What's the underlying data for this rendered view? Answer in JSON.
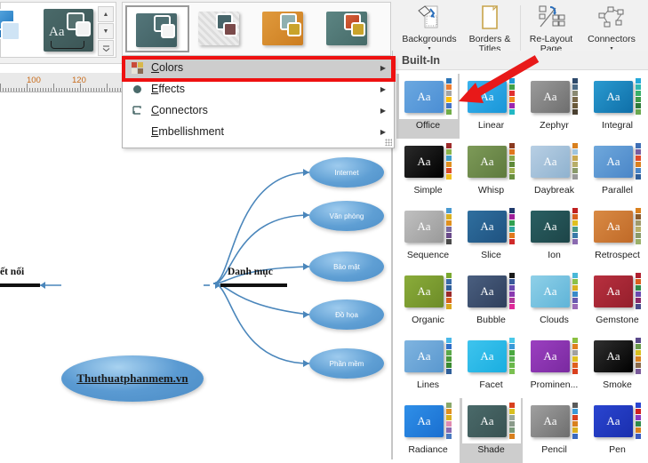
{
  "ribbon": {
    "gallery_thumbs": [
      {
        "name": "theme-thumb-shade",
        "selected": true,
        "base": "#4a6a6a",
        "ov1": "#55706f",
        "ov2": "#f2f2f2"
      },
      {
        "name": "theme-thumb-striped",
        "selected": false,
        "base": "#e8e8e8",
        "ov1": "#47656a",
        "ov2": "#7a4a4a"
      },
      {
        "name": "theme-thumb-orange",
        "selected": false,
        "base": "#d5882c",
        "ov1": "#7fa5a5",
        "ov2": "#c9a32b"
      },
      {
        "name": "theme-thumb-teal-red",
        "selected": false,
        "base": "#507a78",
        "ov1": "#c4502c",
        "ov2": "#c9a32b"
      }
    ],
    "buttons": [
      {
        "label": "Backgrounds",
        "icon": "backgrounds-icon",
        "caret": "▾"
      },
      {
        "label": "Borders &\nTitles",
        "icon": "borders-titles-icon",
        "caret": "▾"
      },
      {
        "label": "Re-Layout\nPage",
        "icon": "relayout-page-icon",
        "caret": "▾"
      },
      {
        "label": "Connectors",
        "icon": "connectors-icon",
        "caret": "▾"
      }
    ],
    "scroll": {
      "up": "▲",
      "down": "▼",
      "more": "▾"
    }
  },
  "menu": {
    "items": [
      {
        "label": "Colors",
        "accel": "C",
        "icon": "colors-swatch-icon",
        "arrow": "▶",
        "highlighted": true
      },
      {
        "label": "Effects",
        "accel": "E",
        "icon": "effects-dot-icon",
        "arrow": "▶",
        "highlighted": false
      },
      {
        "label": "Connectors",
        "accel": "C",
        "icon": "connectors-shape-icon",
        "arrow": "▶",
        "highlighted": false
      },
      {
        "label": "Embellishment",
        "accel": "E",
        "icon": "",
        "arrow": "▶",
        "highlighted": false
      }
    ],
    "highlight_color": "#ee1111"
  },
  "ruler": {
    "marks": [
      "100",
      "120"
    ],
    "unit_color": "#c86a18"
  },
  "mindmap": {
    "center_node": "Thuthuatphanmem.vn",
    "left_branch_label": "ết nối",
    "right_branch_label": "Danh mục",
    "children": [
      "Internet",
      "Văn phòng",
      "Bảo mật",
      "Đồ họa",
      "Phần mềm"
    ],
    "node_color": "#5a9ad2",
    "connector_color": "#4a86bb"
  },
  "panel": {
    "header": "Built-In",
    "themes": [
      {
        "name": "Office",
        "card": "linear-gradient(135deg,#6ba8e0,#4b8ed4)",
        "state": "selected",
        "dots": [
          "#2e75b6",
          "#ed7d31",
          "#a5a5a5",
          "#ffc000",
          "#4472c4",
          "#70ad47"
        ]
      },
      {
        "name": "Linear",
        "card": "linear-gradient(135deg,#3bb3ee,#1996d8)",
        "state": "none",
        "dots": [
          "#1f9ad6",
          "#43a047",
          "#e03030",
          "#f08a1e",
          "#9b27b0",
          "#22b8c4"
        ]
      },
      {
        "name": "Zephyr",
        "card": "linear-gradient(135deg,#9b9b9b,#6e6e6e)",
        "state": "none",
        "dots": [
          "#2e4a6b",
          "#4b6b86",
          "#8a8a72",
          "#7a6a4a",
          "#6b5a3a",
          "#4a4030"
        ]
      },
      {
        "name": "Integral",
        "card": "linear-gradient(135deg,#2a9ad0,#0f6fa8)",
        "state": "none",
        "dots": [
          "#25a8d8",
          "#2fb8b0",
          "#38b06a",
          "#3f9c4a",
          "#2e7a3a",
          "#6aa84f"
        ]
      },
      {
        "name": "Simple",
        "card": "linear-gradient(135deg,#2a2a2a,#000000)",
        "state": "none",
        "dots": [
          "#9e2b2b",
          "#8ab54a",
          "#3f9ec9",
          "#e09020",
          "#d94a2a",
          "#f0c020"
        ]
      },
      {
        "name": "Whisp",
        "card": "linear-gradient(135deg,#7d9a58,#5e7a3e)",
        "state": "none",
        "dots": [
          "#8a3a20",
          "#e0761e",
          "#8aa84a",
          "#5f8a3a",
          "#a0b050",
          "#6a9040"
        ]
      },
      {
        "name": "Daybreak",
        "card": "linear-gradient(135deg,#b8cfe4,#8fb2cf)",
        "state": "none",
        "dots": [
          "#d9801e",
          "#9ec4de",
          "#c9a850",
          "#b8ae6a",
          "#8a9a6a",
          "#9a9a9a"
        ]
      },
      {
        "name": "Parallel",
        "card": "linear-gradient(135deg,#6fa8dc,#4a86c8)",
        "state": "none",
        "dots": [
          "#3f6fb5",
          "#7a5ea0",
          "#e04a2a",
          "#d9801e",
          "#4a86c8",
          "#2f5f9a"
        ]
      },
      {
        "name": "Sequence",
        "card": "linear-gradient(135deg,#c0c0c0,#9a9a9a)",
        "state": "none",
        "dots": [
          "#4a9ad0",
          "#d9b020",
          "#e0901e",
          "#7a6aa0",
          "#6a4a8a",
          "#4a4a4a"
        ]
      },
      {
        "name": "Slice",
        "card": "linear-gradient(135deg,#2f6f9f,#1f5280)",
        "state": "none",
        "dots": [
          "#1f3a6b",
          "#a0209a",
          "#30a050",
          "#30a8a0",
          "#e07a1e",
          "#d02a2a"
        ]
      },
      {
        "name": "Ion",
        "card": "linear-gradient(135deg,#2a5f62,#1d4548)",
        "state": "none",
        "dots": [
          "#c02020",
          "#d9601e",
          "#e0c020",
          "#4a9a8a",
          "#3a7aa8",
          "#8a6ab0"
        ]
      },
      {
        "name": "Retrospect",
        "card": "linear-gradient(135deg,#d98a44,#c06a28)",
        "state": "none",
        "dots": [
          "#d9801e",
          "#8a5a2a",
          "#a09a6a",
          "#b8b06a",
          "#8a9a6a",
          "#9ab06a"
        ]
      },
      {
        "name": "Organic",
        "card": "linear-gradient(135deg,#8aac3a,#6d8c28)",
        "state": "none",
        "dots": [
          "#7aa830",
          "#3a6aa8",
          "#2f5f9a",
          "#9a2a2a",
          "#d9601e",
          "#d9a820"
        ]
      },
      {
        "name": "Bubble",
        "card": "linear-gradient(135deg,#4a5f80,#2f3f5c)",
        "state": "none",
        "dots": [
          "#1a1a1a",
          "#3a5a9a",
          "#6a4ab0",
          "#8a3ab0",
          "#b03a9a",
          "#e02a9a"
        ]
      },
      {
        "name": "Clouds",
        "card": "linear-gradient(135deg,#8fd0e8,#5fb4d8)",
        "state": "none",
        "dots": [
          "#4ab8d8",
          "#8ac04a",
          "#d9b020",
          "#3a8ac8",
          "#6a5ab0",
          "#9a6ab8"
        ]
      },
      {
        "name": "Gemstone",
        "card": "linear-gradient(135deg,#b8303f,#951f2c)",
        "state": "none",
        "dots": [
          "#b02030",
          "#d9601e",
          "#2f8a4a",
          "#6a4ab0",
          "#8a2a6a",
          "#4a4a8a"
        ]
      },
      {
        "name": "Lines",
        "card": "linear-gradient(135deg,#7fb4e0,#5a98cf)",
        "state": "none",
        "dots": [
          "#4ab8e8",
          "#2f6fc8",
          "#5aa84a",
          "#4a9a3a",
          "#3a8a30",
          "#2f5f9a"
        ]
      },
      {
        "name": "Facet",
        "card": "linear-gradient(135deg,#3ec4ee,#1aaee0)",
        "state": "none",
        "dots": [
          "#4ac8e8",
          "#3a9ad8",
          "#4aa840",
          "#5ab050",
          "#6ab84a",
          "#7ac050"
        ]
      },
      {
        "name": "Prominen...",
        "card": "linear-gradient(135deg,#9b3fc0,#7a2aa0)",
        "state": "none",
        "dots": [
          "#8ac040",
          "#e0801e",
          "#a0a0a0",
          "#e0c020",
          "#e0601e",
          "#d9401e"
        ]
      },
      {
        "name": "Smoke",
        "card": "linear-gradient(135deg,#303030,#000000)",
        "state": "none",
        "dots": [
          "#5a4a8a",
          "#6a9a4a",
          "#d9c020",
          "#d9801e",
          "#8a6a4a",
          "#7a5a9a"
        ]
      },
      {
        "name": "Radiance",
        "card": "linear-gradient(135deg,#2f8fe8,#1a6fd0)",
        "state": "none",
        "dots": [
          "#8aa86a",
          "#e0901e",
          "#d9b020",
          "#e08ab0",
          "#8a6ab0",
          "#4a7ac0"
        ]
      },
      {
        "name": "Shade",
        "card": "linear-gradient(135deg,#4a6a6a,#395252)",
        "state": "boxed",
        "dots": [
          "#d9401e",
          "#d9c020",
          "#9aa89a",
          "#8a9a8a",
          "#7a9a7a",
          "#d9801e"
        ]
      },
      {
        "name": "Pencil",
        "card": "linear-gradient(135deg,#a0a0a0,#6e6e6e)",
        "state": "none",
        "dots": [
          "#5a5a5a",
          "#3a9ad8",
          "#d9401e",
          "#d9801e",
          "#d9b020",
          "#3a6ac0"
        ]
      },
      {
        "name": "Pen",
        "card": "linear-gradient(135deg,#2a45d0,#1a2fae)",
        "state": "none",
        "dots": [
          "#2a45d0",
          "#d02020",
          "#8a3ac0",
          "#2f8a4a",
          "#d9801e",
          "#3a5ac0"
        ]
      }
    ]
  }
}
